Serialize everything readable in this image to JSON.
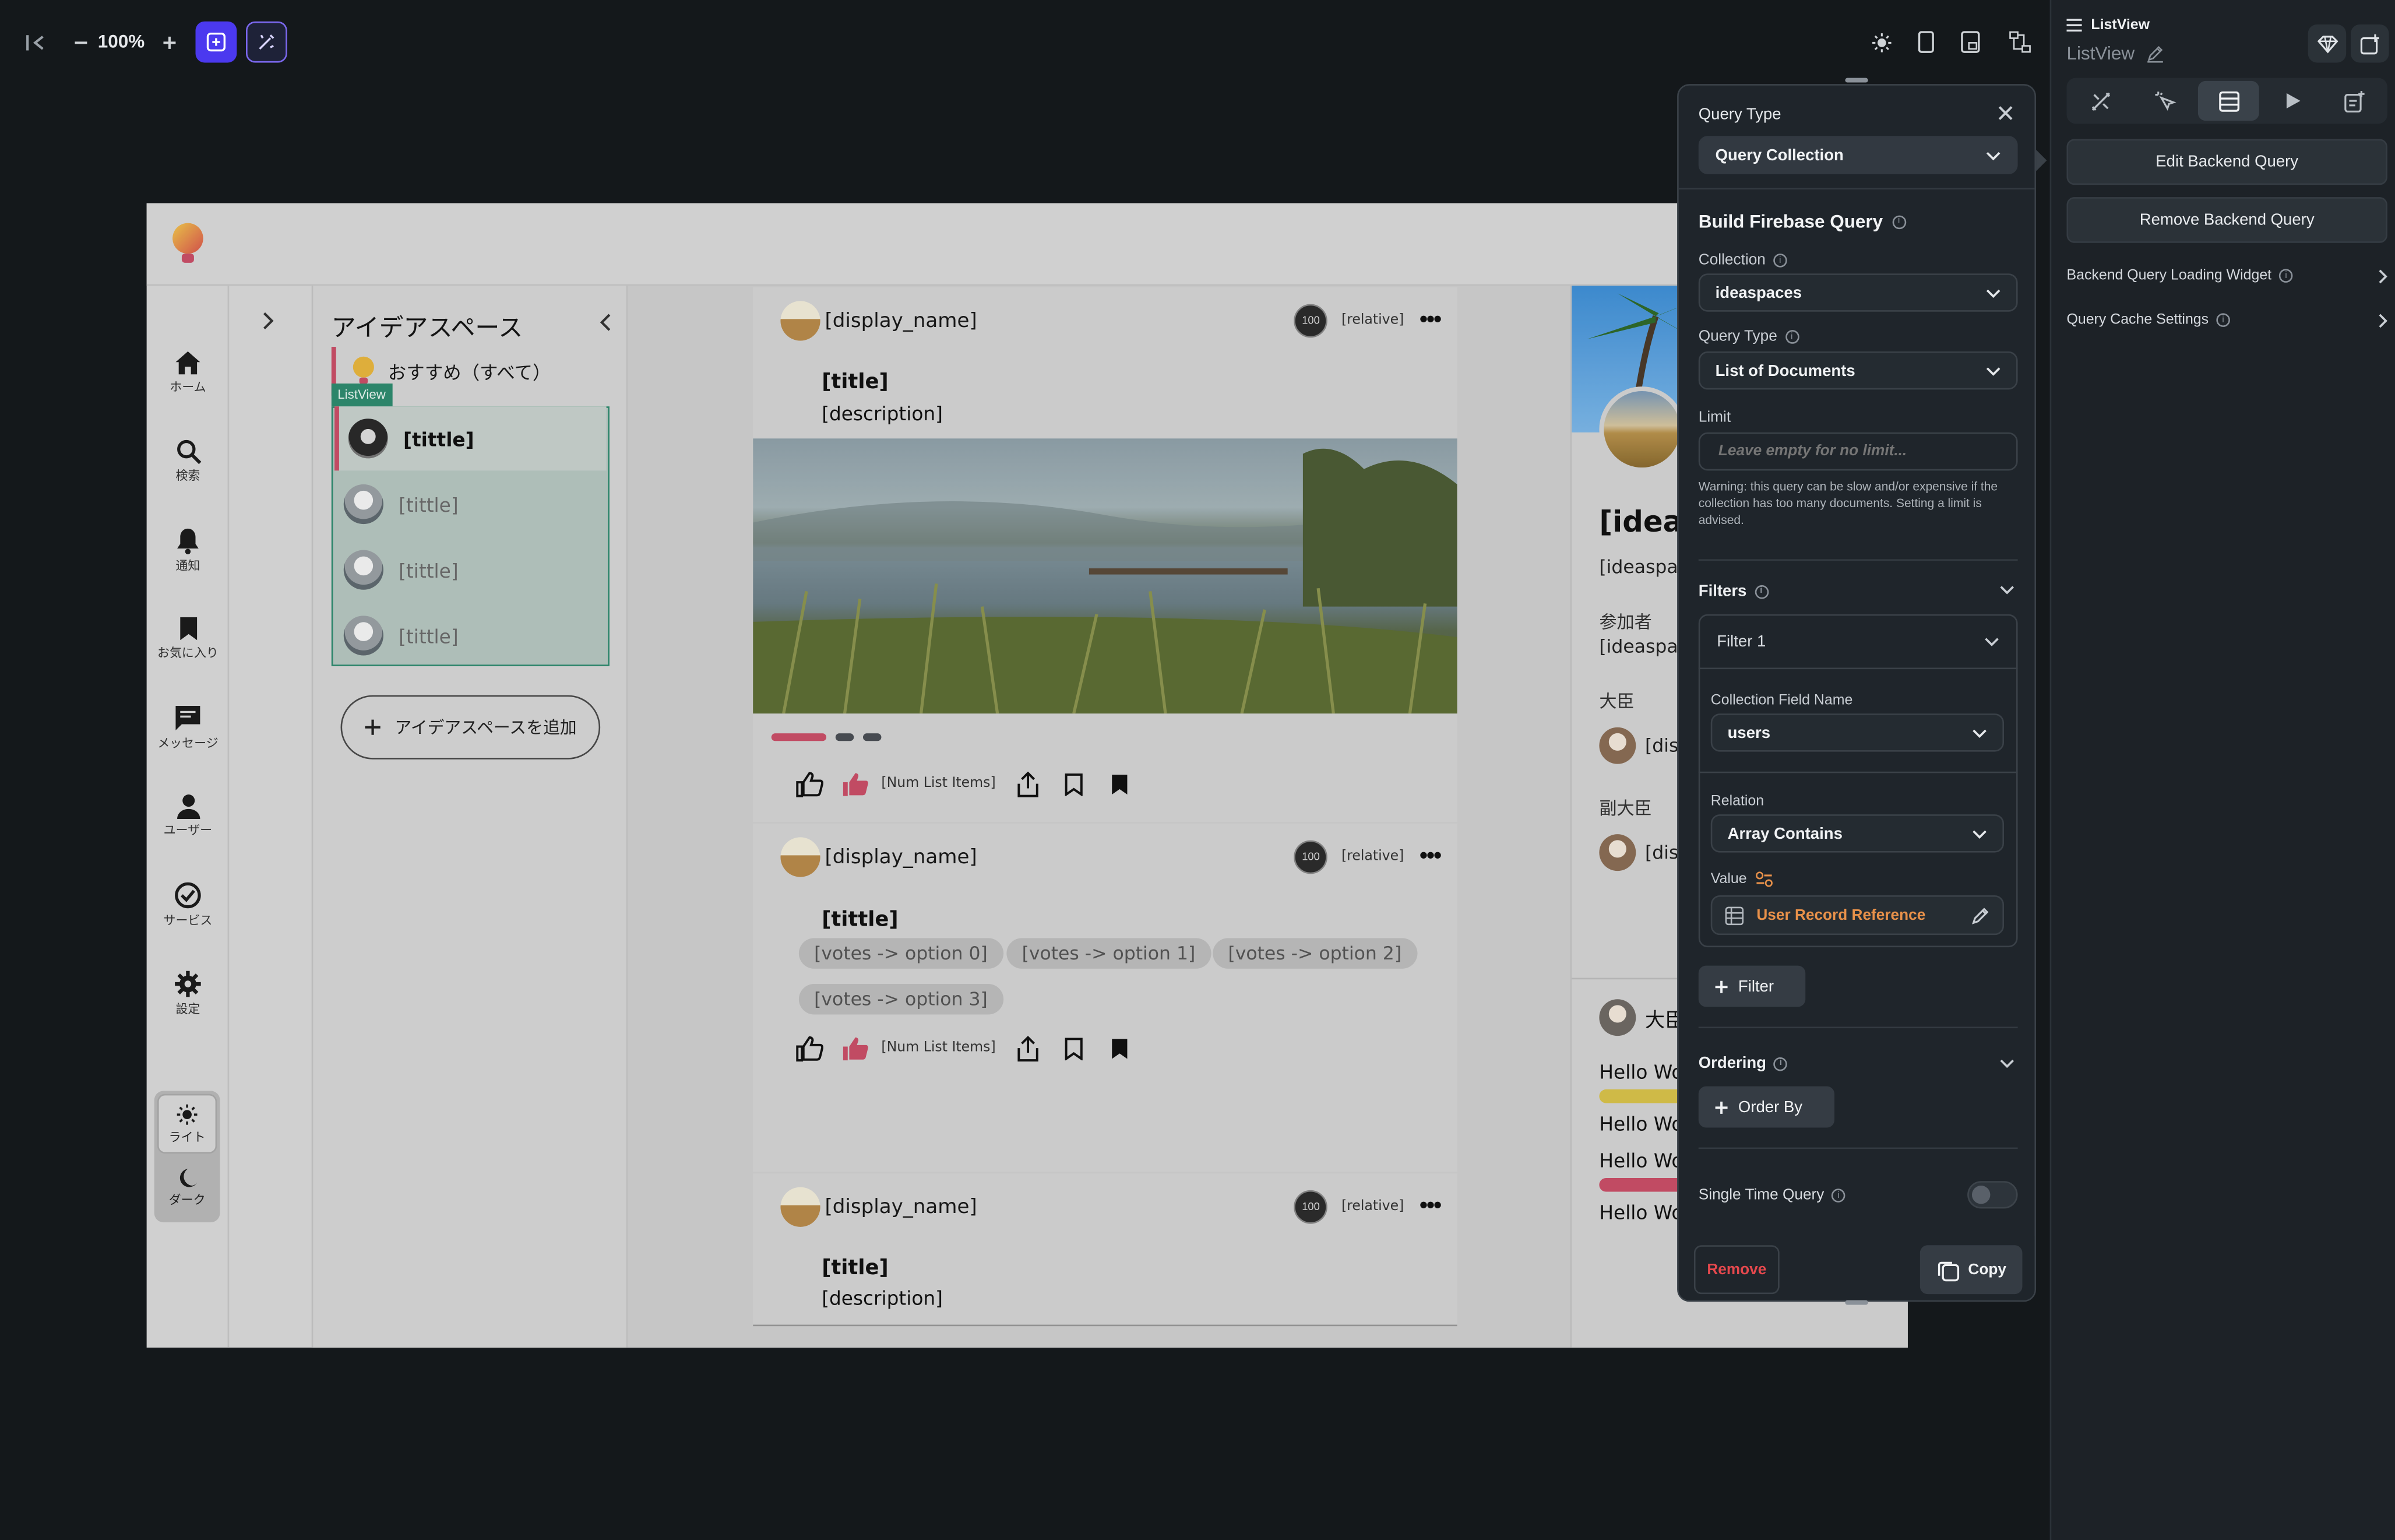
{
  "toolbar": {
    "zoom": "100%",
    "accent": "#4b39ef"
  },
  "rail": {
    "items": [
      {
        "label": "ホーム"
      },
      {
        "label": "検索"
      },
      {
        "label": "通知"
      },
      {
        "label": "お気に入り"
      },
      {
        "label": "メッセージ"
      },
      {
        "label": "ユーザー"
      },
      {
        "label": "サービス"
      },
      {
        "label": "設定"
      }
    ],
    "theme_light": "ライト",
    "theme_dark": "ダーク"
  },
  "ideaspace": {
    "title": "アイデアスペース",
    "recommended": "おすすめ（すべて）",
    "listview_tag": "ListView",
    "items": [
      "[tittle]",
      "[tittle]",
      "[tittle]",
      "[tittle]"
    ],
    "add_button": "アイデアスペースを追加"
  },
  "feed": {
    "display_name": "[display_name]",
    "badge": "100",
    "relative": "[relative]",
    "title": "[title]",
    "tittle": "[tittle]",
    "description": "[description]",
    "num_list_items": "[Num List Items]",
    "votes": [
      "[votes -> option 0]",
      "[votes -> option 1]",
      "[votes -> option 2]",
      "[votes -> option 3]"
    ]
  },
  "detail": {
    "title": "[ideas",
    "subtitle": "[ideaspa",
    "participants": "参加者",
    "participants_value": "[ideaspa",
    "minister": "大臣",
    "minister_value": "[dis",
    "vice_minister": "副大臣",
    "vice_value": "[dis",
    "bottom_name": "大臣",
    "hello": [
      "Hello Wo",
      "Hello Wo",
      "Hello Wo",
      "Hello Wo"
    ]
  },
  "query_panel": {
    "query_type_label": "Query Type",
    "query_type_value": "Query Collection",
    "build_title": "Build Firebase Query",
    "collection_label": "Collection",
    "collection_value": "ideaspaces",
    "query_type2_label": "Query Type",
    "query_type2_value": "List of Documents",
    "limit_label": "Limit",
    "limit_placeholder": "Leave empty for no limit...",
    "warning": "Warning: this query can be slow and/or expensive if the collection has too many documents. Setting a limit is advised.",
    "filters_label": "Filters",
    "filter1": "Filter 1",
    "field_name_label": "Collection Field Name",
    "field_name_value": "users",
    "relation_label": "Relation",
    "relation_value": "Array Contains",
    "value_label": "Value",
    "value_value": "User Record Reference",
    "add_filter": "Filter",
    "ordering_label": "Ordering",
    "order_by": "Order By",
    "single_time": "Single Time Query",
    "remove": "Remove",
    "copy": "Copy",
    "accent_orange": "#e8914a",
    "danger": "#e5484d"
  },
  "props": {
    "widget_type": "ListView",
    "widget_name": "ListView",
    "edit_backend": "Edit Backend Query",
    "remove_backend": "Remove Backend Query",
    "loading_widget": "Backend Query Loading Widget",
    "cache_settings": "Query Cache Settings"
  }
}
